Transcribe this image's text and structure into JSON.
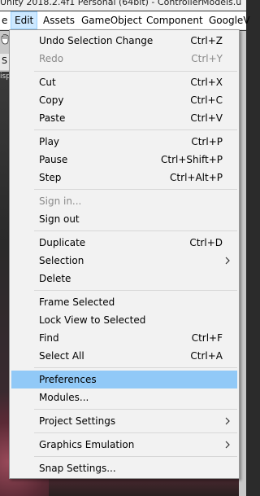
{
  "window": {
    "title": "Unity 2018.2.4f1 Personal (64bit) - ControllerModels.u"
  },
  "menubar": {
    "items": [
      "e",
      "Edit",
      "Assets",
      "GameObject",
      "Component",
      "GoogleV"
    ]
  },
  "background": {
    "toolbar_letter": "S",
    "side_label": "isp"
  },
  "edit_menu": {
    "items": [
      {
        "label": "Undo Selection Change",
        "shortcut": "Ctrl+Z"
      },
      {
        "label": "Redo",
        "shortcut": "Ctrl+Y"
      },
      {
        "label": "Cut",
        "shortcut": "Ctrl+X"
      },
      {
        "label": "Copy",
        "shortcut": "Ctrl+C"
      },
      {
        "label": "Paste",
        "shortcut": "Ctrl+V"
      },
      {
        "label": "Play",
        "shortcut": "Ctrl+P"
      },
      {
        "label": "Pause",
        "shortcut": "Ctrl+Shift+P"
      },
      {
        "label": "Step",
        "shortcut": "Ctrl+Alt+P"
      },
      {
        "label": "Sign in...",
        "shortcut": ""
      },
      {
        "label": "Sign out",
        "shortcut": ""
      },
      {
        "label": "Duplicate",
        "shortcut": "Ctrl+D"
      },
      {
        "label": "Selection",
        "shortcut": ""
      },
      {
        "label": "Delete",
        "shortcut": ""
      },
      {
        "label": "Frame Selected",
        "shortcut": ""
      },
      {
        "label": "Lock View to Selected",
        "shortcut": ""
      },
      {
        "label": "Find",
        "shortcut": "Ctrl+F"
      },
      {
        "label": "Select All",
        "shortcut": "Ctrl+A"
      },
      {
        "label": "Preferences",
        "shortcut": ""
      },
      {
        "label": "Modules...",
        "shortcut": ""
      },
      {
        "label": "Project Settings",
        "shortcut": ""
      },
      {
        "label": "Graphics Emulation",
        "shortcut": ""
      },
      {
        "label": "Snap Settings...",
        "shortcut": ""
      }
    ]
  },
  "colors": {
    "menu_bg": "#f2f2f2",
    "highlight": "#91c9f7",
    "active_menu": "#cce8ff",
    "disabled_text": "#8a8a8a"
  }
}
